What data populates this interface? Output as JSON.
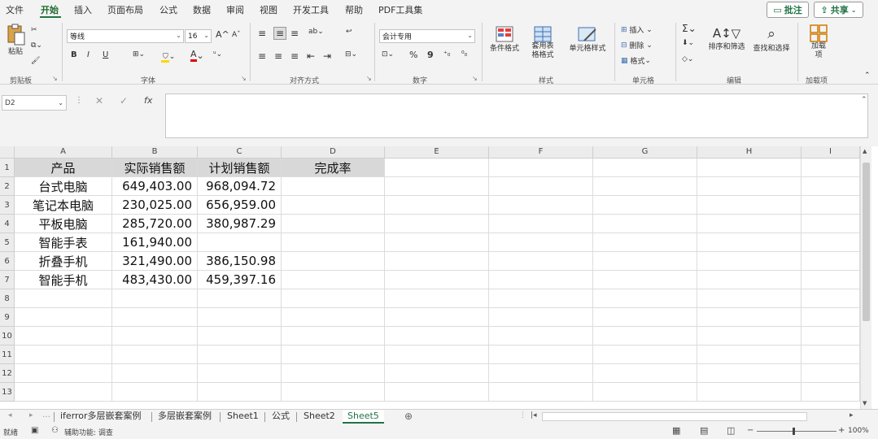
{
  "menu": {
    "items": [
      "文件",
      "开始",
      "插入",
      "页面布局",
      "公式",
      "数据",
      "审阅",
      "视图",
      "开发工具",
      "帮助",
      "PDF工具集"
    ],
    "comment_button": "批注",
    "share_button": "共享"
  },
  "ribbon": {
    "clipboard": {
      "paste": "粘贴",
      "group": "剪贴板"
    },
    "font": {
      "name": "等线",
      "size": "16",
      "bold": "B",
      "italic": "I",
      "underline": "U",
      "grow": "A",
      "shrink": "A",
      "color_letter": "A",
      "group": "字体",
      "accent_fill": "#ffd700",
      "accent_font": "#e00000"
    },
    "alignment": {
      "group": "对齐方式"
    },
    "number": {
      "format": "会计专用",
      "percent": "%",
      "comma": "9",
      "group": "数字"
    },
    "styles": {
      "conditional": "条件格式",
      "table_format": "套用表格格式",
      "cell_style": "单元格样式",
      "group": "样式"
    },
    "cells": {
      "insert": "插入",
      "delete": "删除",
      "format": "格式",
      "group": "单元格"
    },
    "editing": {
      "sum": "Σ",
      "sort": "排序和筛选",
      "find": "查找和选择",
      "group": "编辑"
    },
    "addins": {
      "label": "加载项",
      "group": "加载项"
    }
  },
  "formula": {
    "cell_ref": "D2",
    "fx": "fx",
    "value": ""
  },
  "sheet": {
    "columns": [
      "A",
      "B",
      "C",
      "D",
      "E",
      "F",
      "G",
      "H",
      "I"
    ],
    "rows": [
      "1",
      "2",
      "3",
      "4",
      "5",
      "6",
      "7",
      "8",
      "9",
      "10",
      "11",
      "12",
      "13"
    ],
    "header": [
      "产品",
      "实际销售额",
      "计划销售额",
      "完成率"
    ],
    "data": [
      [
        "台式电脑",
        "649,403.00",
        "968,094.72",
        ""
      ],
      [
        "笔记本电脑",
        "230,025.00",
        "656,959.00",
        ""
      ],
      [
        "平板电脑",
        "285,720.00",
        "380,987.29",
        ""
      ],
      [
        "智能手表",
        "161,940.00",
        "",
        ""
      ],
      [
        "折叠手机",
        "321,490.00",
        "386,150.98",
        ""
      ],
      [
        "智能手机",
        "483,430.00",
        "459,397.16",
        ""
      ]
    ]
  },
  "tabs": {
    "items": [
      "iferror多层嵌套案例",
      "多层嵌套案例",
      "Sheet1",
      "公式",
      "Sheet2",
      "Sheet5"
    ],
    "active": "Sheet5"
  },
  "status": {
    "ready": "就绪",
    "accessibility": "辅助功能: 调查",
    "zoom": "100%"
  }
}
